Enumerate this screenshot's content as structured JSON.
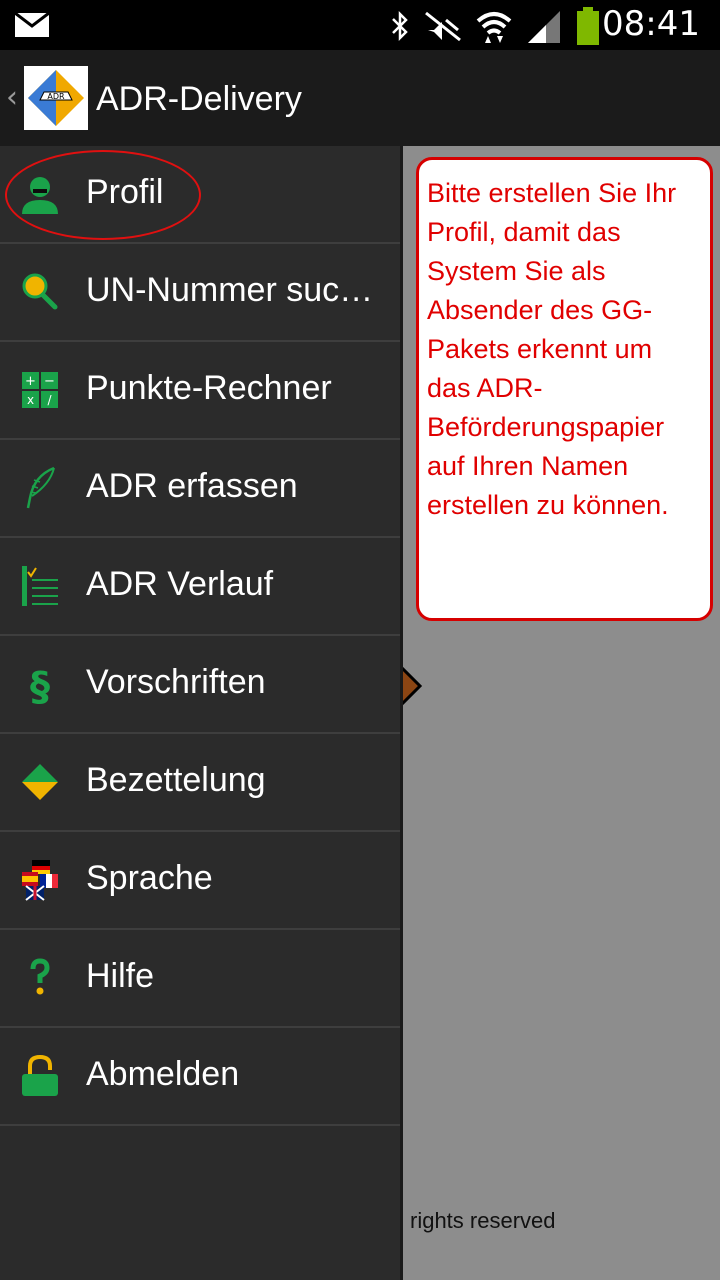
{
  "status_bar": {
    "time": "08:41",
    "icons": [
      "mail-icon",
      "bluetooth-icon",
      "mute-icon",
      "wifi-icon",
      "signal-icon",
      "battery-icon"
    ]
  },
  "action_bar": {
    "title": "ADR-Delivery",
    "logo_label": "ADR"
  },
  "drawer": {
    "items": [
      {
        "label": "Profil",
        "icon": "profile-icon"
      },
      {
        "label": "UN-Nummer suchen",
        "icon": "search-icon"
      },
      {
        "label": "Punkte-Rechner",
        "icon": "calculator-icon"
      },
      {
        "label": "ADR erfassen",
        "icon": "quill-icon"
      },
      {
        "label": "ADR Verlauf",
        "icon": "checklist-icon"
      },
      {
        "label": "Vorschriften",
        "icon": "paragraph-icon"
      },
      {
        "label": "Bezettelung",
        "icon": "label-diamond-icon"
      },
      {
        "label": "Sprache",
        "icon": "language-flags-icon"
      },
      {
        "label": "Hilfe",
        "icon": "help-icon"
      },
      {
        "label": "Abmelden",
        "icon": "lock-icon"
      }
    ]
  },
  "hint": {
    "text": "Bitte erstellen Sie Ihr Profil, damit das System Sie als Absender des GG-Pakets erkennt um das ADR-Beförderungspapier auf Ihren Namen erstellen zu können."
  },
  "footer": {
    "text": "rights reserved"
  },
  "colors": {
    "drawer_bg": "#2b2b2b",
    "accent_green": "#1aa34a",
    "hint_red": "#e00000"
  }
}
